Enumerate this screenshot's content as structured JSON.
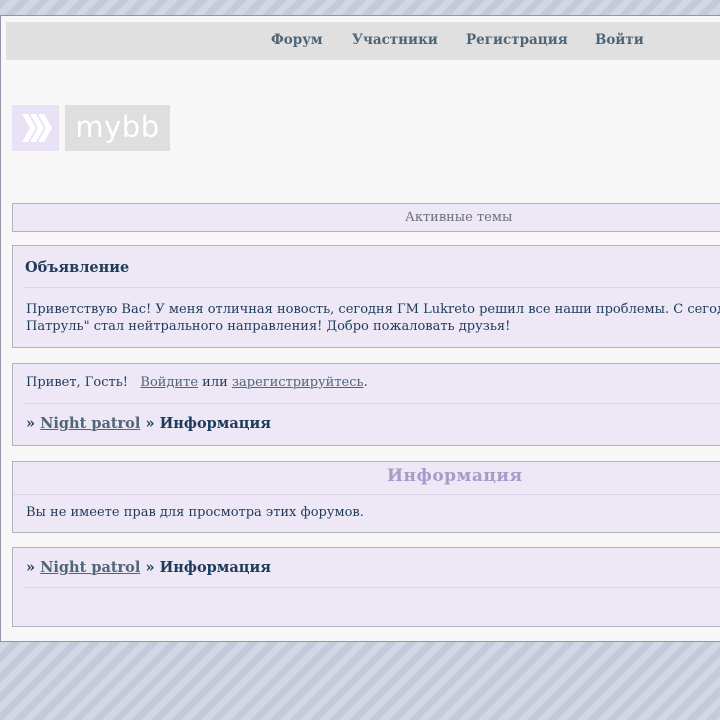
{
  "navbar": {
    "items": [
      {
        "label": "Форум"
      },
      {
        "label": "Участники"
      },
      {
        "label": "Регистрация"
      },
      {
        "label": "Войти"
      }
    ]
  },
  "logo": {
    "text": "mybb"
  },
  "active_topics": {
    "label": "Активные темы"
  },
  "announcement": {
    "title": "Объявление",
    "text": "Приветствую Вас! У меня отличная новость, сегодня ГМ Lukreto решил все наши проблемы. С сегод",
    "text2": "Патруль\" стал нейтрального направления! Добро пожаловать друзья!"
  },
  "welcome": {
    "greeting": "Привет, Гость!",
    "login_link": "Войдите",
    "or": "или",
    "register_link": "зарегистрируйтесь",
    "period": "."
  },
  "breadcrumb": {
    "sep": "»",
    "forum_link": "Night patrol",
    "current": "Информация"
  },
  "info": {
    "title": "Информация",
    "message": "Вы не имеете прав для просмотра этих форумов."
  },
  "colors": {
    "background": "#c4cad9",
    "box": "#ede7f6",
    "text": "#1e3c59",
    "link": "#4e6678",
    "accent": "#a99bc8"
  }
}
